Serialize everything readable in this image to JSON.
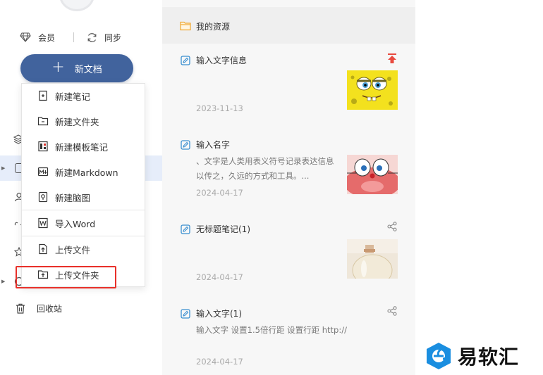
{
  "sidebar": {
    "member_label": "会员",
    "sync_label": "同步",
    "new_doc_label": "新文档",
    "trash_label": "回收站"
  },
  "menu": {
    "items": [
      {
        "label": "新建笔记",
        "icon": "new-note-icon"
      },
      {
        "label": "新建文件夹",
        "icon": "new-folder-icon"
      },
      {
        "label": "新建模板笔记",
        "icon": "template-note-icon"
      },
      {
        "label": "新建Markdown",
        "icon": "markdown-icon"
      },
      {
        "label": "新建脑图",
        "icon": "mindmap-icon"
      },
      {
        "label": "导入Word",
        "icon": "import-word-icon"
      },
      {
        "label": "上传文件",
        "icon": "upload-file-icon"
      },
      {
        "label": "上传文件夹",
        "icon": "upload-folder-icon"
      }
    ],
    "highlighted_item": "上传文件夹"
  },
  "list": {
    "header_title": "我的资源",
    "notes": [
      {
        "title": "输入文字信息",
        "excerpt": "",
        "date": "2023-11-13",
        "pinned": true,
        "thumbnail": "yellow-cartoon-sponge"
      },
      {
        "title": "输入名字",
        "excerpt": "、文字是人类用表义符号记录表达信息以传之，久远的方式和工具。...",
        "date": "2024-04-17",
        "thumbnail": "cartoon-cat-face"
      },
      {
        "title": "无标题笔记(1)",
        "excerpt": "",
        "date": "2024-04-17",
        "thumbnail": "glass-bottle"
      },
      {
        "title": "输入文字(1)",
        "excerpt": "输入文字 设置1.5倍行距 设置行距 http://",
        "date": "2024-04-17",
        "thumbnail": ""
      }
    ]
  },
  "watermark": {
    "text": "易软汇"
  },
  "colors": {
    "accent": "#41639d",
    "selection": "#e6edfa",
    "highlight_border": "#e8302a",
    "pin": "#e84a3f",
    "folder": "#f0a830",
    "note_icon": "#3a8fd0"
  }
}
